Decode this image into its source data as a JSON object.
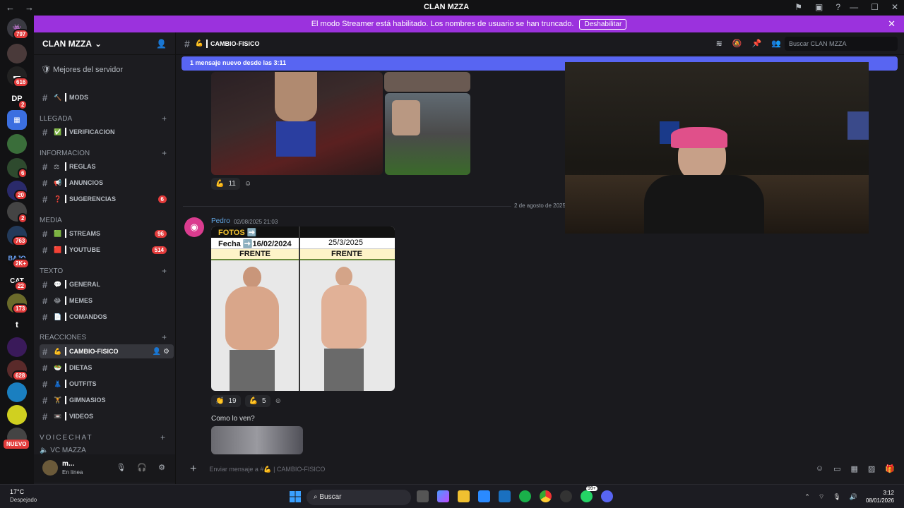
{
  "window": {
    "title": "CLAN MZZA"
  },
  "banner": {
    "text": "El modo Streamer está habilitado. Los nombres de usuario se han truncado.",
    "disable_label": "Deshabilitar"
  },
  "server": {
    "name": "CLAN MZZA",
    "mejores": "Mejores del servidor"
  },
  "server_badges": [
    "797",
    "616",
    "2",
    "6",
    "20",
    "2",
    "763",
    "2K+",
    "22",
    "173",
    "628"
  ],
  "server_labels": {
    "dp": "DP",
    "cat": "CAT",
    "t": "t",
    "bajo": "BAJO",
    "nuevo": "NUEVO"
  },
  "categories": {
    "llegada": "LLEGADA",
    "informacion": "INFORMACION",
    "media": "MEDIA",
    "texto": "TEXTO",
    "reacciones": "REACCIONES",
    "voicechat": "VOICECHAT"
  },
  "channels": {
    "mods": "MODS",
    "verificacion": "VERIFICACION",
    "reglas": "REGLAS",
    "anuncios": "ANUNCIOS",
    "sugerencias": "SUGERENCIAS",
    "sugerencias_count": "6",
    "streams": "STREAMS",
    "streams_count": "96",
    "youtube": "YOUTUBE",
    "youtube_count": "514",
    "general": "GENERAL",
    "memes": "MEMES",
    "comandos": "COMANDOS",
    "cambio_fisico": "CAMBIO-FISICO",
    "dietas": "DIETAS",
    "outfits": "OUTFITS",
    "gimnasios": "GIMNASIOS",
    "videos": "VIDEOS",
    "vc_mazza": "VC MAZZA"
  },
  "user": {
    "name": "m...",
    "status": "En línea"
  },
  "chat": {
    "channel": "CAMBIO-FISICO",
    "search_placeholder": "Buscar CLAN MZZA",
    "new_messages": "1 mensaje nuevo desde las 3:11",
    "date_separator": "2 de agosto de 2025",
    "msg1_reaction_count": "11",
    "author": "Pedro",
    "timestamp": "02/08/2025 21:03",
    "img_fotos": "FOTOS ➡️",
    "img_fecha": "Fecha ➡️16/02/2024",
    "img_date2": "25/3/2025",
    "img_frente": "FRENTE",
    "reaction1_count": "19",
    "reaction2_count": "5",
    "message_text": "Como lo ven?",
    "composer_placeholder": "Enviar mensaje a #💪 | CAMBIO-FISICO"
  },
  "taskbar": {
    "temp": "17°C",
    "weather": "Despejado",
    "search": "Buscar",
    "time": "3:12",
    "date": "08/01/2026",
    "wa_badge": "99+"
  }
}
